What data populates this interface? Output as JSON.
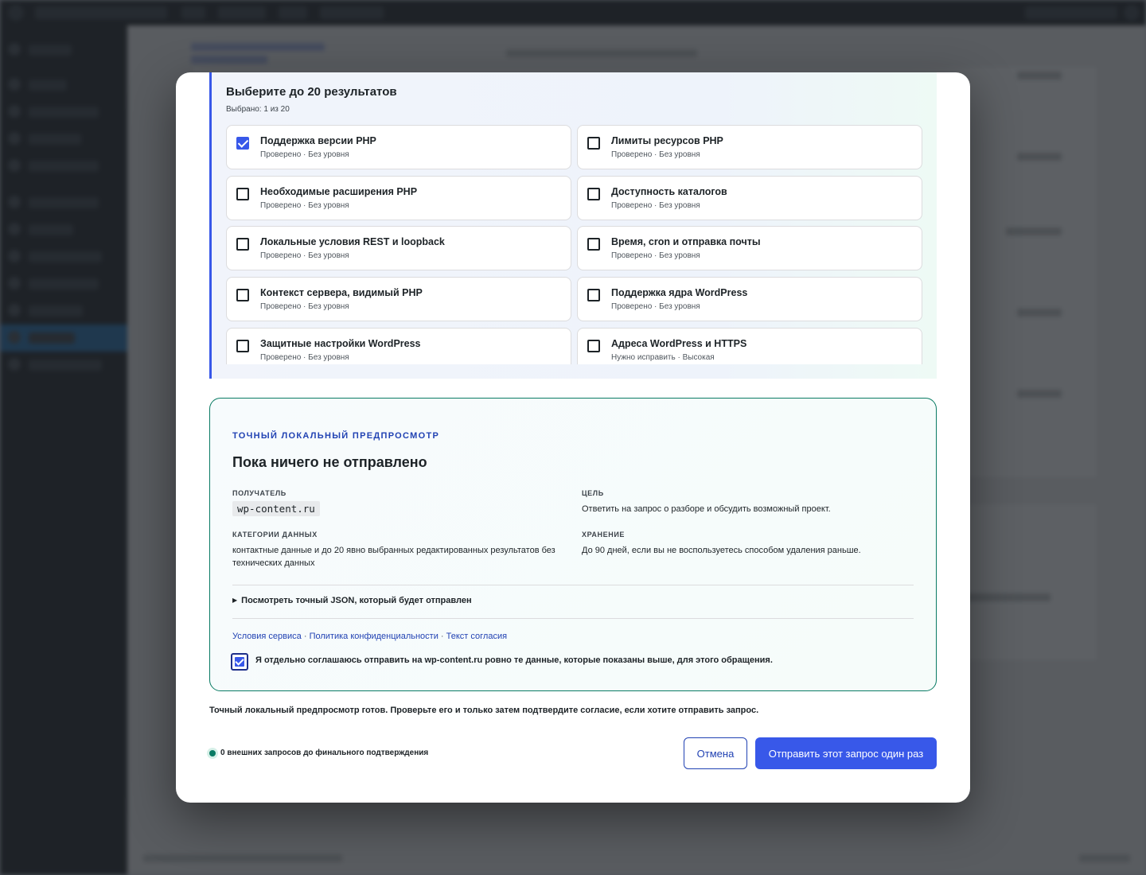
{
  "results": {
    "title": "Выберите до 20 результатов",
    "count_text": "Выбрано: 1 из 20",
    "items": [
      {
        "title": "Поддержка версии PHP",
        "subtitle": "Проверено · Без уровня",
        "checked": true
      },
      {
        "title": "Лимиты ресурсов PHP",
        "subtitle": "Проверено · Без уровня",
        "checked": false
      },
      {
        "title": "Необходимые расширения PHP",
        "subtitle": "Проверено · Без уровня",
        "checked": false
      },
      {
        "title": "Доступность каталогов",
        "subtitle": "Проверено · Без уровня",
        "checked": false
      },
      {
        "title": "Локальные условия REST и loopback",
        "subtitle": "Проверено · Без уровня",
        "checked": false
      },
      {
        "title": "Время, cron и отправка почты",
        "subtitle": "Проверено · Без уровня",
        "checked": false
      },
      {
        "title": "Контекст сервера, видимый PHP",
        "subtitle": "Проверено · Без уровня",
        "checked": false
      },
      {
        "title": "Поддержка ядра WordPress",
        "subtitle": "Проверено · Без уровня",
        "checked": false
      },
      {
        "title": "Защитные настройки WordPress",
        "subtitle": "Проверено · Без уровня",
        "checked": false
      },
      {
        "title": "Адреса WordPress и HTTPS",
        "subtitle": "Нужно исправить · Высокая",
        "checked": false
      }
    ]
  },
  "preview": {
    "eyebrow": "ТОЧНЫЙ ЛОКАЛЬНЫЙ ПРЕДПРОСМОТР",
    "title": "Пока ничего не отправлено",
    "recipient_label": "ПОЛУЧАТЕЛЬ",
    "recipient_value": "wp-content.ru",
    "purpose_label": "ЦЕЛЬ",
    "purpose_value": "Ответить на запрос о разборе и обсудить возможный проект.",
    "categories_label": "КАТЕГОРИИ ДАННЫХ",
    "categories_value": "контактные данные и до 20 явно выбранных редактированных результатов без технических данных",
    "storage_label": "ХРАНЕНИЕ",
    "storage_value": "До 90 дней, если вы не воспользуетесь способом удаления раньше.",
    "json_summary": "Посмотреть точный JSON, который будет отправлен",
    "links": {
      "terms": "Условия сервиса",
      "privacy": "Политика конфиденциальности",
      "consent_text": "Текст согласия",
      "separator": "·"
    },
    "consent_label": "Я отдельно соглашаюсь отправить на wp-content.ru ровно те данные, которые показаны выше, для этого обращения.",
    "consent_checked": true
  },
  "footer": {
    "ready_text": "Точный локальный предпросмотр готов. Проверьте его и только затем подтвердите согласие, если хотите отправить запрос.",
    "external_requests": "0 внешних запросов до финального подтверждения",
    "cancel_label": "Отмена",
    "send_label": "Отправить этот запрос один раз"
  }
}
